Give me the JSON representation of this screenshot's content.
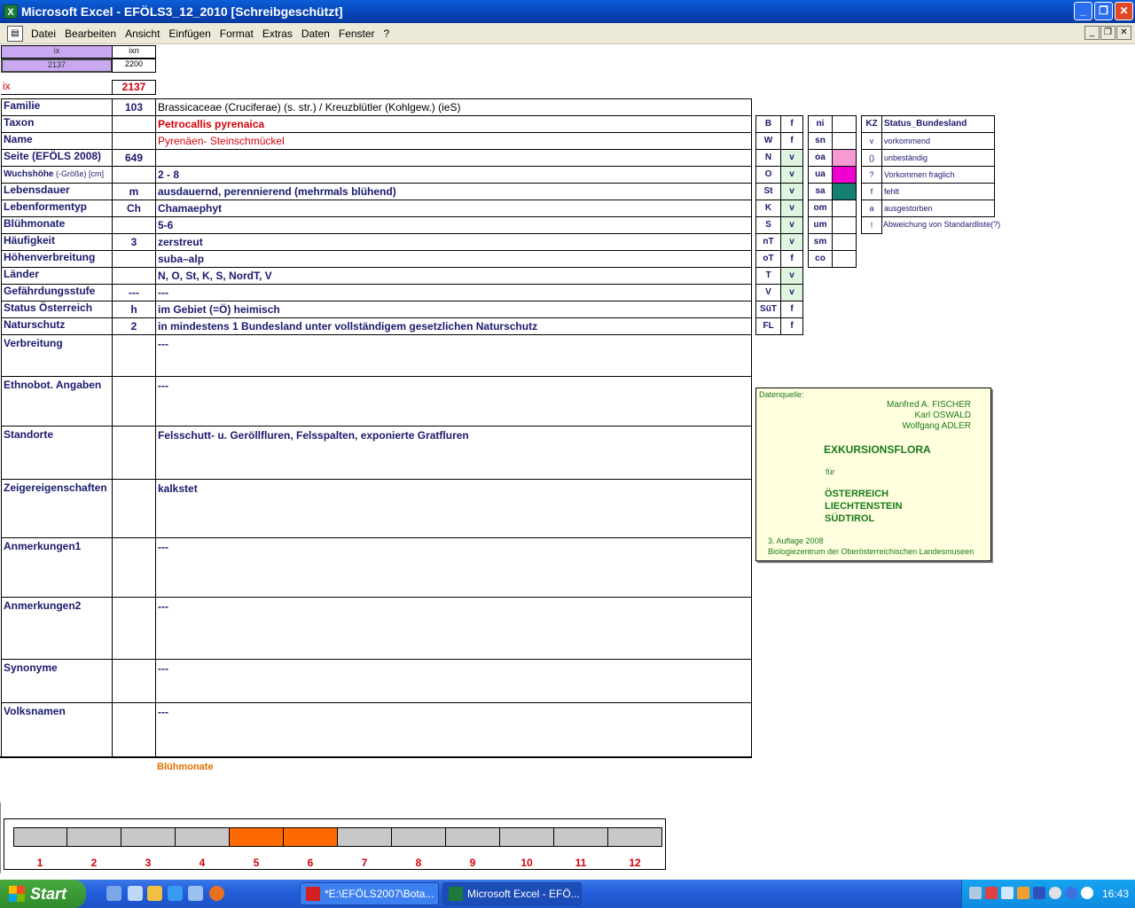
{
  "window": {
    "title": "Microsoft Excel - EFÖLS3_12_2010  [Schreibgeschützt]",
    "app_icon": "excel-icon",
    "buttons": [
      "minimize",
      "maximize",
      "close"
    ]
  },
  "menu": {
    "items": [
      "Datei",
      "Bearbeiten",
      "Ansicht",
      "Einfügen",
      "Format",
      "Extras",
      "Daten",
      "Fenster",
      "?"
    ]
  },
  "index_box": {
    "ix_header": "ix",
    "ixn_header": "ixn",
    "ix_value": "2137",
    "ixn_value": "2200",
    "ix_label": "ix",
    "ix_big_value": "2137"
  },
  "rows": [
    {
      "label": "Familie",
      "code": "103",
      "value": "Brassicaceae (Cruciferae) (s. str.)  /  Kreuzblütler (Kohlgew.) (ieS)"
    },
    {
      "label": "Taxon",
      "code": "",
      "value": "Petrocallis pyrenaica"
    },
    {
      "label": "Name",
      "code": "",
      "value": "Pyrenäen- Steinschmückel"
    },
    {
      "label": "Seite (EFÖLS 2008)",
      "code": "649",
      "value": ""
    },
    {
      "label": "Wuchshöhe",
      "label_small": "(-Größe) [cm]",
      "code": "",
      "value": " 2 - 8"
    },
    {
      "label": "Lebensdauer",
      "code": "m",
      "value": "ausdauernd, perennierend (mehrmals blühend)"
    },
    {
      "label": "Lebenformentyp",
      "code": "Ch",
      "value": "Chamaephyt"
    },
    {
      "label": "Blühmonate",
      "code": "",
      "value": " 5-6"
    },
    {
      "label": "Häufigkeit",
      "code": "3",
      "value": "zerstreut"
    },
    {
      "label": "Höhenverbreitung",
      "code": "",
      "value": "suba–alp"
    },
    {
      "label": "Länder",
      "code": "",
      "value": "N, O, St, K, S, NordT, V"
    },
    {
      "label": "Gefährdungsstufe",
      "code": "---",
      "value": "   ---"
    },
    {
      "label": "Status Österreich",
      "code": "h",
      "value": "im Gebiet (=Ö) heimisch"
    },
    {
      "label": "Naturschutz",
      "code": "2",
      "value": "in mindestens 1 Bundesland unter vollständigem gesetzlichen Naturschutz"
    }
  ],
  "long_rows": [
    {
      "label": "Verbreitung",
      "value": " ---"
    },
    {
      "label": "Ethnobot. Angaben",
      "value": "---"
    },
    {
      "label": "Standorte",
      "value": "Felsschutt- u. Geröllfluren, Felsspalten, exponierte Gratfluren"
    },
    {
      "label": "Zeigereigenschaften",
      "value": "kalkstet"
    },
    {
      "label": "Anmerkungen1",
      "value": "---"
    },
    {
      "label": "Anmerkungen2",
      "value": "---"
    },
    {
      "label": "Synonyme",
      "value": "---"
    },
    {
      "label": "Volksnamen",
      "value": "---"
    }
  ],
  "states": [
    {
      "code": "B",
      "status": "f"
    },
    {
      "code": "W",
      "status": "f"
    },
    {
      "code": "N",
      "status": "v"
    },
    {
      "code": "O",
      "status": "v"
    },
    {
      "code": "St",
      "status": "v"
    },
    {
      "code": "K",
      "status": "v"
    },
    {
      "code": "S",
      "status": "v"
    },
    {
      "code": "nT",
      "status": "v"
    },
    {
      "code": "oT",
      "status": "f"
    },
    {
      "code": "T",
      "status": "v"
    },
    {
      "code": "V",
      "status": "v"
    },
    {
      "code": "SüT",
      "status": "f"
    },
    {
      "code": "FL",
      "status": "f"
    }
  ],
  "altitude": [
    {
      "code": "ni",
      "color": ""
    },
    {
      "code": "sn",
      "color": ""
    },
    {
      "code": "oa",
      "color": "#f79ad4"
    },
    {
      "code": "ua",
      "color": "#f000d0"
    },
    {
      "code": "sa",
      "color": "#168070"
    },
    {
      "code": "om",
      "color": ""
    },
    {
      "code": "um",
      "color": ""
    },
    {
      "code": "sm",
      "color": ""
    },
    {
      "code": "co",
      "color": ""
    }
  ],
  "legend": {
    "header_kz": "KZ",
    "header_status": "Status_Bundesland",
    "items": [
      {
        "kz": "v",
        "text": "vorkommend"
      },
      {
        "kz": "()",
        "text": "unbeständig"
      },
      {
        "kz": "?",
        "text": "Vorkommen fraglich"
      },
      {
        "kz": "f",
        "text": "fehlt"
      },
      {
        "kz": "a",
        "text": "ausgestorben"
      },
      {
        "kz": "!",
        "text": "Abweichung von Standardliste(?)"
      }
    ]
  },
  "source": {
    "label": "Datenquelle:",
    "authors": [
      "Manfred A. FISCHER",
      "Karl OSWALD",
      "Wolfgang ADLER"
    ],
    "title": "EXKURSIONSFLORA",
    "fuer": "für",
    "regions": [
      "ÖSTERREICH",
      "LIECHTENSTEIN",
      "SÜDTIROL"
    ],
    "edition": "3. Auflage 2008",
    "publisher": "Biologiezentrum der Oberösterreichischen Landesmuseen"
  },
  "bloom": {
    "title": "Blühmonate",
    "months": [
      "1",
      "2",
      "3",
      "4",
      "5",
      "6",
      "7",
      "8",
      "9",
      "10",
      "11",
      "12"
    ],
    "active": [
      5,
      6
    ],
    "active_color": "#ff6a00",
    "inactive_color": "#c8c8c8"
  },
  "taskbar": {
    "start": "Start",
    "tasks": [
      "*E:\\EFÖLS2007\\Bota...",
      "Microsoft Excel - EFÖ..."
    ],
    "clock": "16:43"
  }
}
